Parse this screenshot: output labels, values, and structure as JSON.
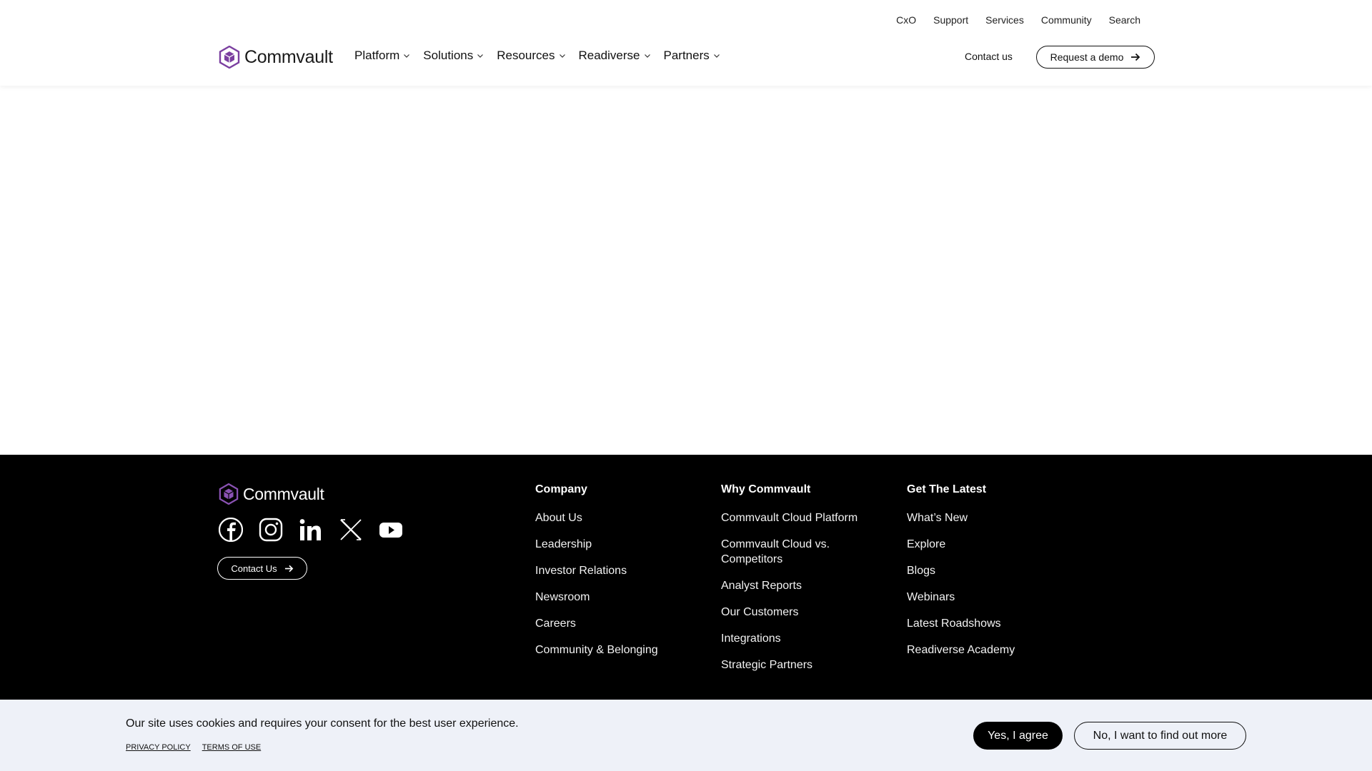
{
  "colors": {
    "brand_purple": "#7b3fa0",
    "footer_bg": "#000000",
    "cookie_bg": "#eef1f8"
  },
  "header": {
    "logo_text": "Commvault",
    "utility_nav": [
      "CxO",
      "Support",
      "Services",
      "Community",
      "Search"
    ],
    "main_nav": [
      {
        "label": "Platform",
        "icon": "chevron-down-icon"
      },
      {
        "label": "Solutions",
        "icon": "chevron-down-icon"
      },
      {
        "label": "Resources",
        "icon": "chevron-down-icon"
      },
      {
        "label": "Readiverse",
        "icon": "chevron-down-icon"
      },
      {
        "label": "Partners",
        "icon": "chevron-down-icon"
      }
    ],
    "contact_label": "Contact us",
    "demo_label": "Request a demo"
  },
  "footer": {
    "logo_text": "Commvault",
    "social_icons": [
      "facebook-icon",
      "instagram-icon",
      "linkedin-icon",
      "x-icon",
      "youtube-icon"
    ],
    "contact_label": "Contact Us",
    "columns": [
      {
        "title": "Company",
        "items": [
          "About Us",
          "Leadership",
          "Investor Relations",
          "Newsroom",
          "Careers",
          "Community & Belonging"
        ]
      },
      {
        "title": "Why Commvault",
        "items": [
          "Commvault Cloud Platform",
          "Commvault Cloud vs. Competitors",
          "Analyst Reports",
          "Our Customers",
          "Integrations",
          "Strategic Partners"
        ]
      },
      {
        "title": "Get The Latest",
        "items": [
          "What’s New",
          "Explore",
          "Blogs",
          "Webinars",
          "Latest Roadshows",
          "Readiverse Academy"
        ]
      }
    ]
  },
  "cookie": {
    "message": "Our site uses cookies and requires your consent for the best user experience.",
    "privacy_link": "PRIVACY POLICY",
    "terms_link": "TERMS OF USE",
    "agree_label": "Yes, I agree",
    "more_label": "No, I want to find out more"
  }
}
